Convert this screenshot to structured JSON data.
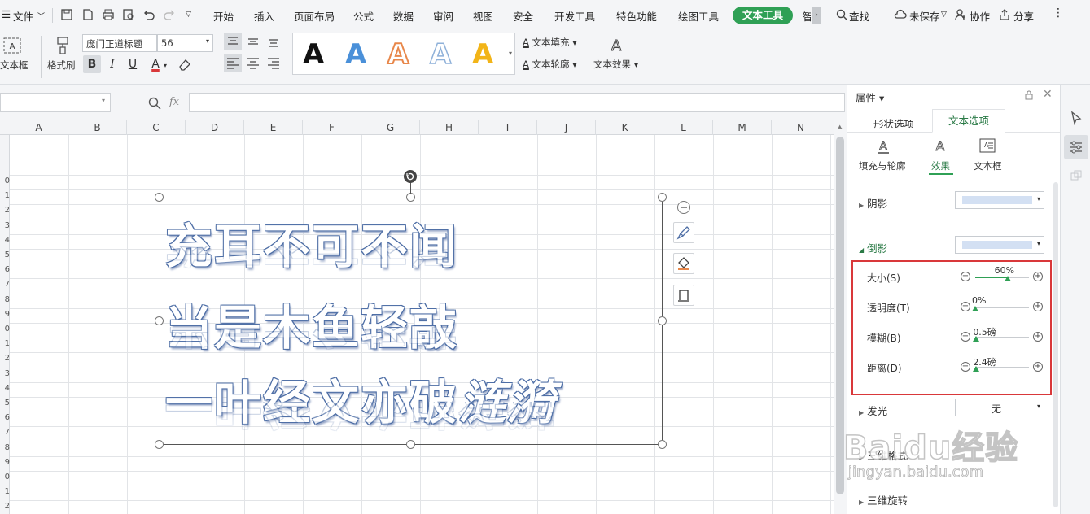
{
  "menubar": {
    "file_label": "文件",
    "tabs": [
      "开始",
      "插入",
      "页面布局",
      "公式",
      "数据",
      "审阅",
      "视图",
      "安全",
      "开发工具",
      "特色功能",
      "绘图工具",
      "文本工具",
      "智"
    ],
    "active_tab": "文本工具",
    "search_label": "查找",
    "unsaved_label": "未保存",
    "collab_label": "协作",
    "share_label": "分享"
  },
  "ribbon": {
    "textbox_label": "文本框",
    "format_painter_label": "格式刷",
    "font_name": "庞门正道标题",
    "font_size": "56",
    "bold": "B",
    "italic": "I",
    "underline": "U",
    "font_color": "A",
    "wordart_glyph": "A",
    "text_fill_label": "文本填充",
    "text_outline_label": "文本轮廓",
    "text_effect_label": "文本效果",
    "wordart_colors": [
      "#111111",
      "#4a90d9",
      "#e8874a",
      "#8fb1d9",
      "#f2b418"
    ]
  },
  "formula": {
    "fx_label": "fx",
    "name_box": "",
    "content": ""
  },
  "grid": {
    "columns": [
      "A",
      "B",
      "C",
      "D",
      "E",
      "F",
      "G",
      "H",
      "I",
      "J",
      "K",
      "L",
      "M",
      "N"
    ],
    "rows": [
      "0",
      "1",
      "2",
      "3",
      "4",
      "5",
      "6",
      "7",
      "8",
      "9",
      "0",
      "1",
      "2",
      "3",
      "4",
      "5",
      "6",
      "7",
      "8",
      "9",
      "0",
      "1",
      "2"
    ]
  },
  "wordart": {
    "line1": "充耳不可不闻",
    "line2": "当是木鱼轻敲",
    "line3a": "一叶经文亦破",
    "line3b": "涟漪",
    "outline_color": "#4f6fa6"
  },
  "panel": {
    "title": "属性",
    "tab_shape": "形状选项",
    "tab_text": "文本选项",
    "subtab_fill": "填充与轮廓",
    "subtab_effect": "效果",
    "subtab_textbox": "文本框",
    "shadow_label": "阴影",
    "reflection_label": "倒影",
    "glow_label": "发光",
    "glow_value": "无",
    "threed_format_label": "三维格式",
    "threed_rotate_label": "三维旋转",
    "size_label": "大小(S)",
    "size_value": "60%",
    "size_fraction": 0.6,
    "transparency_label": "透明度(T)",
    "transparency_value": "0%",
    "transparency_fraction": 0.0,
    "blur_label": "模糊(B)",
    "blur_value": "0.5磅",
    "blur_fraction": 0.02,
    "distance_label": "距离(D)",
    "distance_value": "2.4磅",
    "distance_fraction": 0.02,
    "accent_color": "#2fa055",
    "highlight_color": "#d9383a"
  },
  "watermark": {
    "brand": "Baidu经验",
    "url": "jingyan.baidu.com"
  }
}
